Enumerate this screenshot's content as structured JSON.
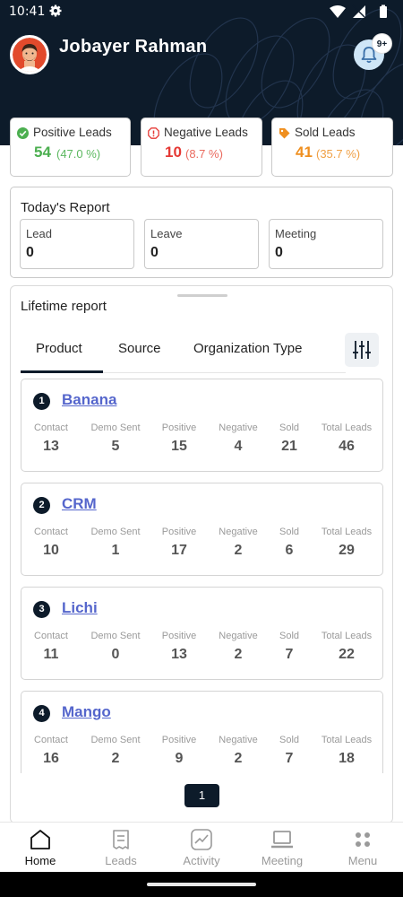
{
  "status_bar": {
    "time": "10:41"
  },
  "profile": {
    "name": "Jobayer Rahman",
    "notification_badge": "9+"
  },
  "lead_stats": {
    "positive": {
      "label": "Positive Leads",
      "count": "54",
      "percent": "(47.0 %)",
      "color": "#4caf50"
    },
    "negative": {
      "label": "Negative Leads",
      "count": "10",
      "percent": "(8.7 %)",
      "color": "#e53935"
    },
    "sold": {
      "label": "Sold Leads",
      "count": "41",
      "percent": "(35.7 %)",
      "color": "#ef8f1f"
    }
  },
  "today_report": {
    "title": "Today's Report",
    "items": [
      {
        "label": "Lead",
        "value": "0"
      },
      {
        "label": "Leave",
        "value": "0"
      },
      {
        "label": "Meeting",
        "value": "0"
      }
    ]
  },
  "lifetime_report": {
    "title": "Lifetime report",
    "tabs": [
      {
        "label": "Product",
        "active": true
      },
      {
        "label": "Source",
        "active": false
      },
      {
        "label": "Organization Type",
        "active": false
      }
    ],
    "column_headers": [
      "Contact",
      "Demo Sent",
      "Positive",
      "Negative",
      "Sold",
      "Total Leads"
    ],
    "products": [
      {
        "rank": "1",
        "name": "Banana",
        "values": [
          "13",
          "5",
          "15",
          "4",
          "21",
          "46"
        ]
      },
      {
        "rank": "2",
        "name": "CRM",
        "values": [
          "10",
          "1",
          "17",
          "2",
          "6",
          "29"
        ]
      },
      {
        "rank": "3",
        "name": "Lichi",
        "values": [
          "11",
          "0",
          "13",
          "2",
          "7",
          "22"
        ]
      },
      {
        "rank": "4",
        "name": "Mango",
        "values": [
          "16",
          "2",
          "9",
          "2",
          "7",
          "18"
        ]
      }
    ],
    "current_page": "1"
  },
  "bottom_nav": [
    {
      "label": "Home",
      "icon": "home-icon",
      "active": true
    },
    {
      "label": "Leads",
      "icon": "leads-icon",
      "active": false
    },
    {
      "label": "Activity",
      "icon": "activity-icon",
      "active": false
    },
    {
      "label": "Meeting",
      "icon": "laptop-icon",
      "active": false
    },
    {
      "label": "Menu",
      "icon": "grid-icon",
      "active": false
    }
  ]
}
